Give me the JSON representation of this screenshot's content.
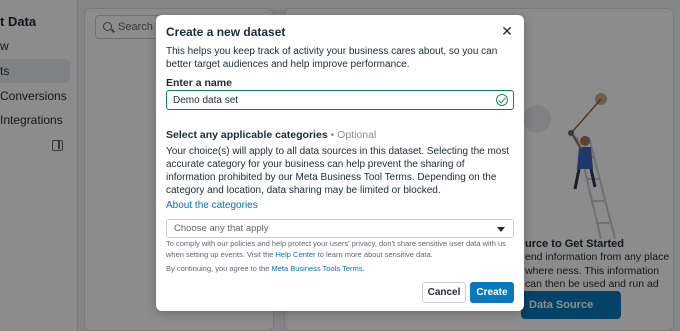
{
  "sidebar": {
    "title": "t Data",
    "items": [
      {
        "label": "w"
      },
      {
        "label": "ts"
      },
      {
        "label": "Conversions"
      },
      {
        "label": "Integrations"
      }
    ]
  },
  "left_panel": {
    "search_placeholder": "Search by"
  },
  "empty_state": {
    "title": "urce to Get Started",
    "description": "end information from any place where ness. This information can then be used and run ad campaigns.",
    "button_label": "Data Source"
  },
  "modal": {
    "title": "Create a new dataset",
    "close_glyph": "✕",
    "description": "This helps you keep track of activity your business cares about, so you can better target audiences and help improve performance.",
    "name_label": "Enter a name",
    "name_value": "Demo data set",
    "categories_title": "Select any applicable categories",
    "categories_optional": " • Optional",
    "categories_description": "Your choice(s) will apply to all data sources in this dataset. Selecting the most accurate category for your business can help prevent the sharing of information prohibited by our Meta Business Tool Terms. Depending on the category and location, data sharing may be limited or blocked.",
    "about_link": "About the categories",
    "select_placeholder": "Choose any that apply",
    "legal_part1": "To comply with our policies and help protect your users' privacy, don't share sensitive user data with us when setting up events. Visit the ",
    "legal_link": "Help Center",
    "legal_part2": " to learn more about sensitive data.",
    "consent_part1": "By continuing, you agree to the ",
    "consent_link": "Meta Business Tools Terms.",
    "cancel_label": "Cancel",
    "create_label": "Create"
  },
  "colors": {
    "accent": "#0a78be",
    "success": "#1f8a4c",
    "overlay": "rgba(0,0,0,0.45)"
  }
}
